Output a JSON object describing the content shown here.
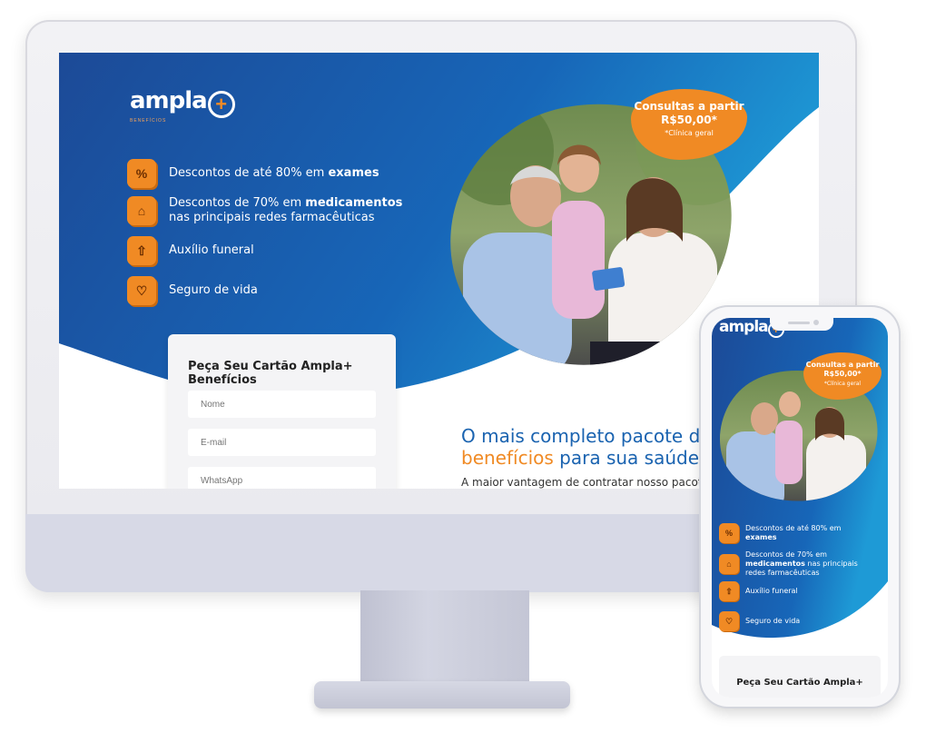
{
  "brand": {
    "name": "ampla",
    "plus": "+",
    "sub": "BENEFÍCIOS"
  },
  "badge": {
    "line1": "Consultas a partir",
    "line2": "R$50,00*",
    "note": "*Clínica geral"
  },
  "features": [
    {
      "icon": "percent-icon",
      "glyph": "%",
      "pre": "Descontos de até 80% em ",
      "bold": "exames",
      "post": ""
    },
    {
      "icon": "tag-icon",
      "glyph": "⌂",
      "pre": "Descontos de 70% em ",
      "bold": "medicamentos",
      "post": " nas principais redes farmacêuticas"
    },
    {
      "icon": "house-icon",
      "glyph": "⇧",
      "pre": "Auxílio funeral",
      "bold": "",
      "post": ""
    },
    {
      "icon": "heart-icon",
      "glyph": "♡",
      "pre": "Seguro de vida",
      "bold": "",
      "post": ""
    }
  ],
  "form": {
    "title": "Peça Seu Cartão Ampla+ Benefícios",
    "fields": [
      {
        "placeholder": "Nome"
      },
      {
        "placeholder": "E-mail"
      },
      {
        "placeholder": "WhatsApp"
      }
    ]
  },
  "headline": {
    "part1": "O mais completo pacote de ",
    "highlight": "benefícios",
    "part2": " para sua saúde!"
  },
  "body_text": "A maior vantagem de contratar nosso pacote de",
  "phone": {
    "features": [
      {
        "pre": "Descontos de até 80% em ",
        "bold": "exames",
        "post": ""
      },
      {
        "pre": "Descontos de 70% em ",
        "bold": "medicamentos",
        "post": " nas principais redes farmacêuticas"
      },
      {
        "pre": "Auxílio funeral",
        "bold": "",
        "post": ""
      },
      {
        "pre": "Seguro de vida",
        "bold": "",
        "post": ""
      }
    ],
    "form_title": "Peça Seu Cartão Ampla+"
  },
  "colors": {
    "blue_dark": "#1c4f9c",
    "blue_light": "#1f8fd0",
    "orange": "#f08a24"
  }
}
